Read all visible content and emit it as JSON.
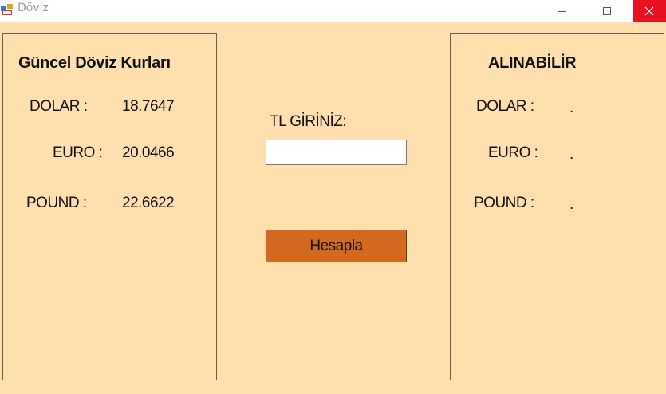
{
  "window": {
    "title": "Döviz"
  },
  "rates_panel": {
    "heading": "Güncel Döviz Kurları",
    "rows": [
      {
        "label": "DOLAR :",
        "value": "18.7647"
      },
      {
        "label": "EURO :",
        "value": "20.0466"
      },
      {
        "label": "POUND :",
        "value": "22.6622"
      }
    ]
  },
  "input_area": {
    "label": "TL GİRİNİZ:",
    "value": "",
    "button_label": "Hesapla"
  },
  "result_panel": {
    "heading": "ALINABİLİR",
    "rows": [
      {
        "label": "DOLAR :",
        "value": "."
      },
      {
        "label": "EURO :",
        "value": "."
      },
      {
        "label": "POUND :",
        "value": "."
      }
    ]
  },
  "colors": {
    "form_background": "#ffdfae",
    "button_background": "#d2691e",
    "close_button": "#e81123"
  },
  "icons": [
    "app-icon",
    "minimize-icon",
    "maximize-icon",
    "close-icon"
  ]
}
